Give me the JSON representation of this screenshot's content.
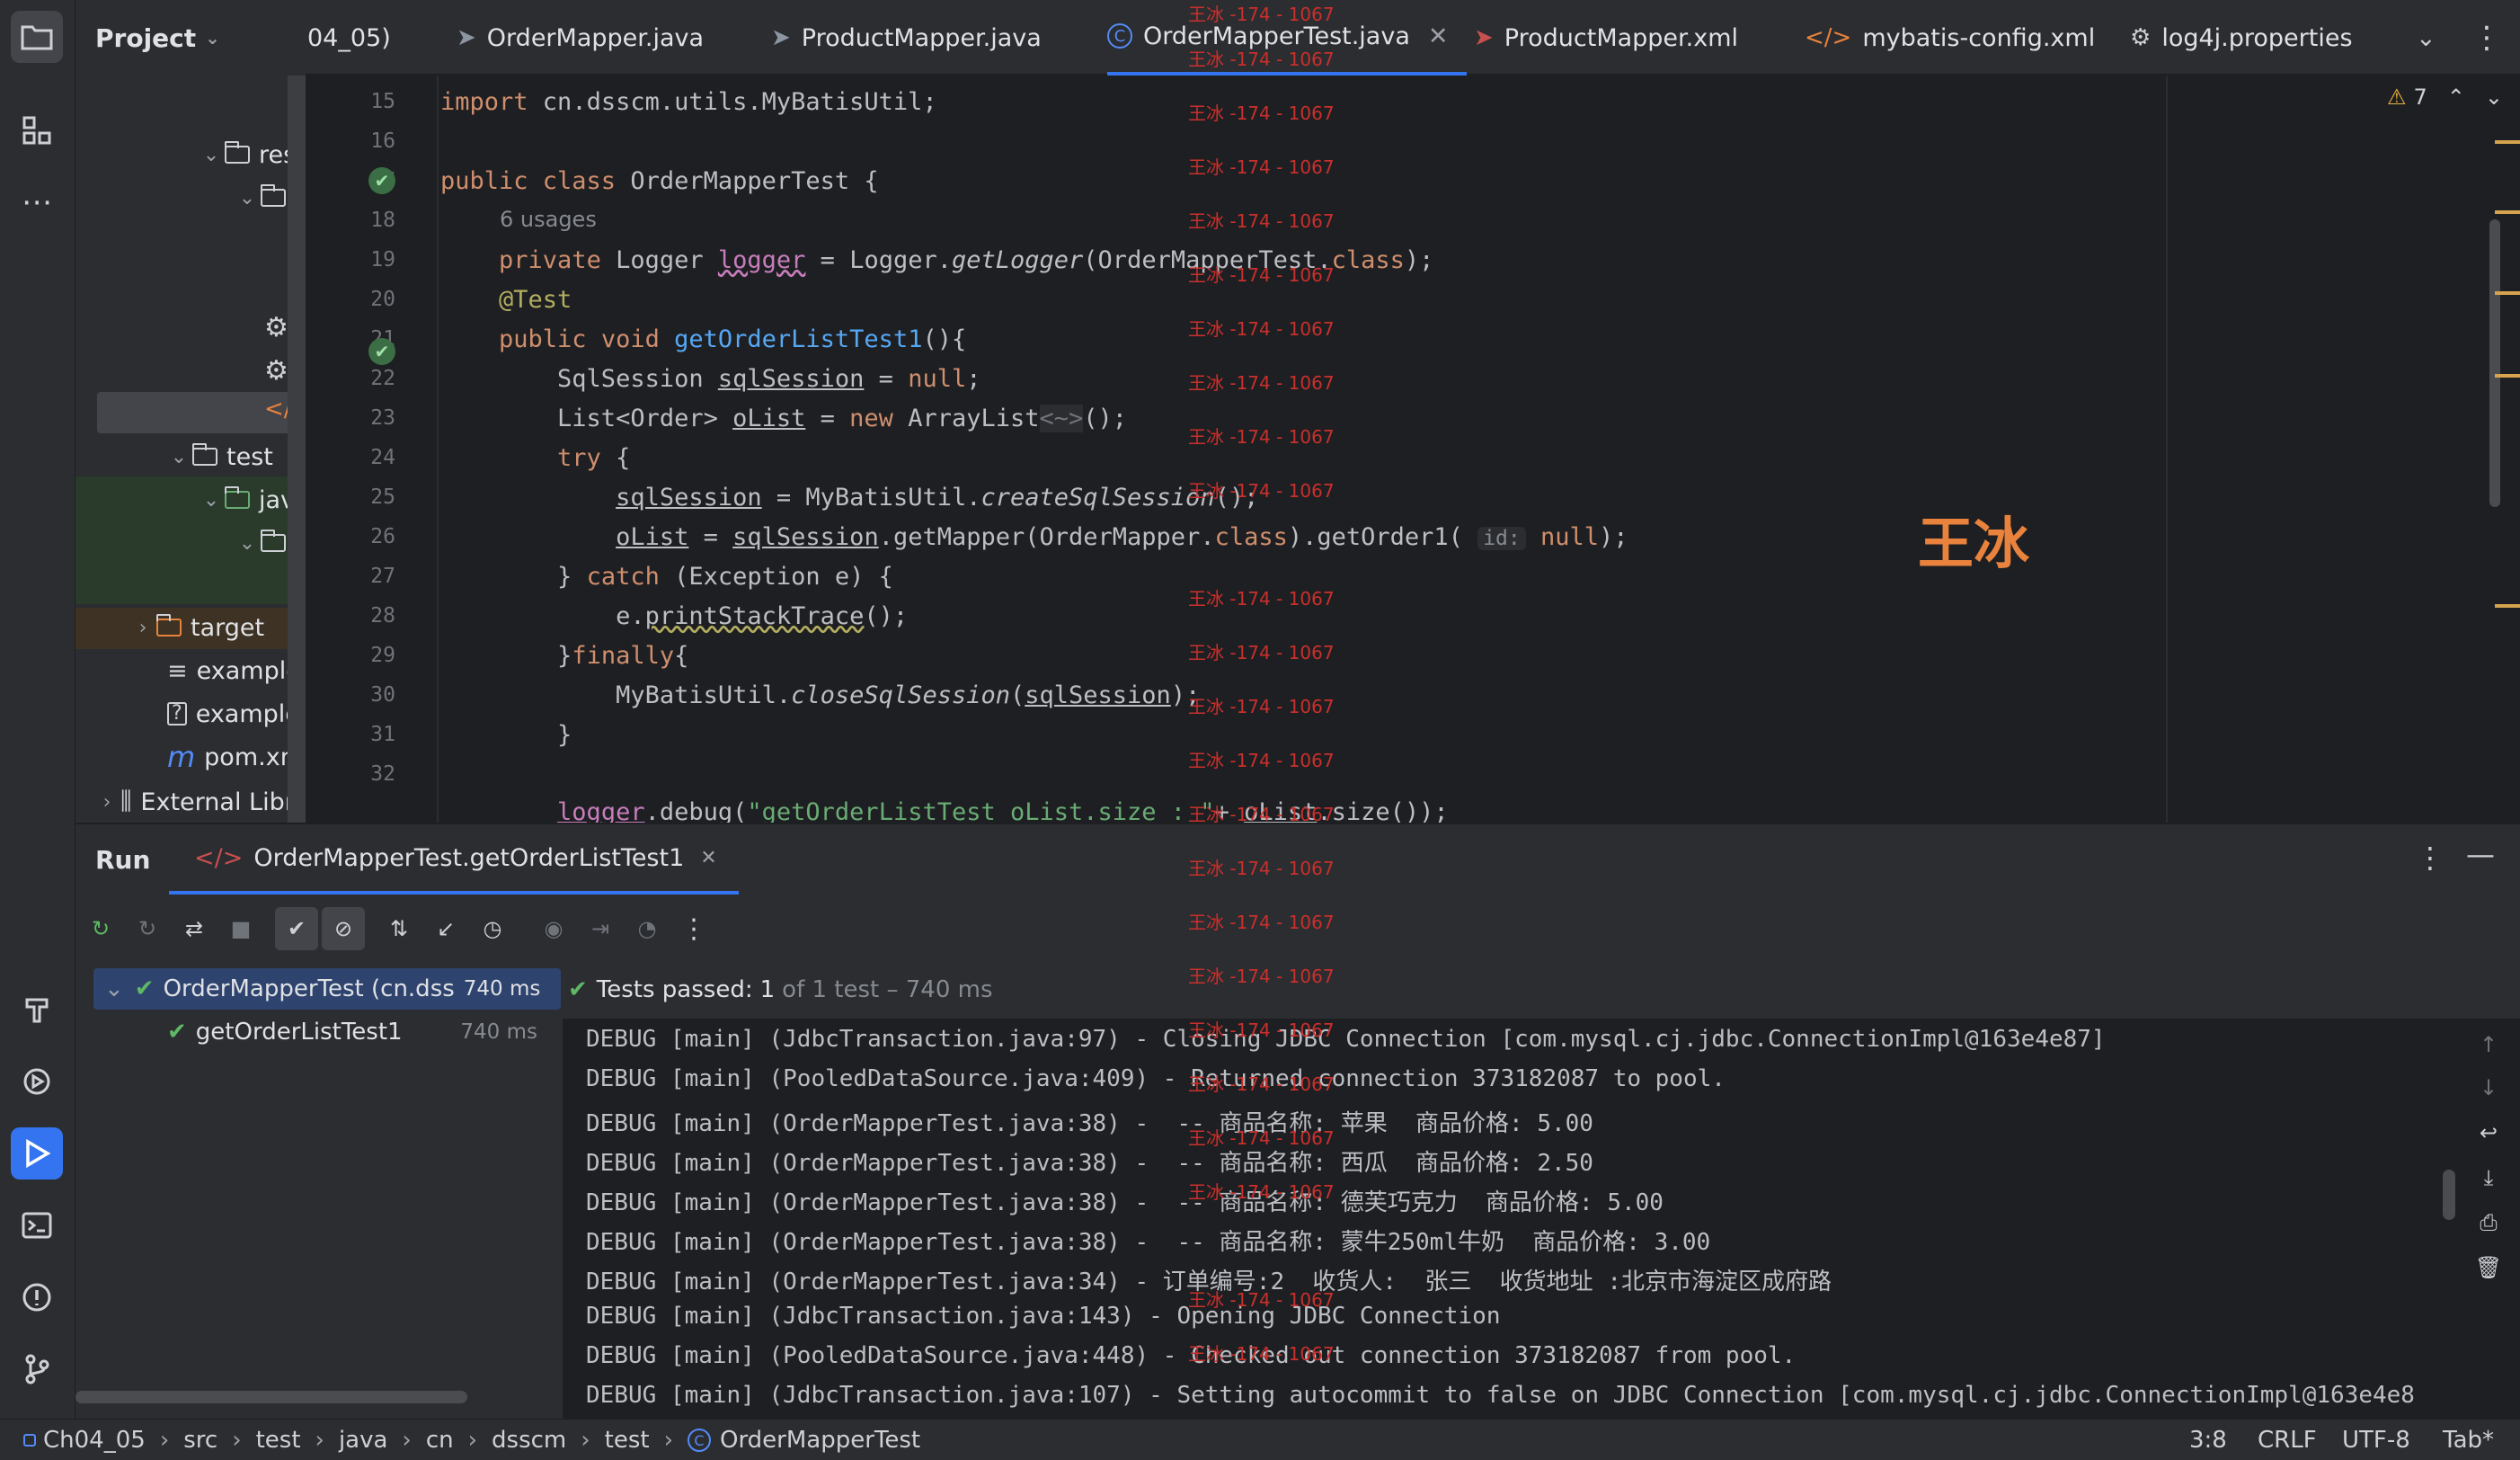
{
  "project_panel": {
    "title": "Project",
    "tree": [
      {
        "label": "res"
      },
      {
        "label": ""
      },
      {
        "label": "test"
      },
      {
        "label": "java"
      },
      {
        "label": ""
      },
      {
        "label": "target"
      },
      {
        "label": "example.l"
      },
      {
        "label": "example.l"
      },
      {
        "label": "pom.xml"
      },
      {
        "label": "External Libr"
      }
    ]
  },
  "tabs": [
    {
      "label": "04_05)",
      "icon": "none"
    },
    {
      "label": "OrderMapper.java",
      "icon": "mapper-icon"
    },
    {
      "label": "ProductMapper.java",
      "icon": "mapper-icon"
    },
    {
      "label": "OrderMapperTest.java",
      "icon": "class-icon",
      "active": true
    },
    {
      "label": "ProductMapper.xml",
      "icon": "mapper-xml-icon"
    },
    {
      "label": "mybatis-config.xml",
      "icon": "xml-icon"
    },
    {
      "label": "log4j.properties",
      "icon": "gear-icon"
    }
  ],
  "editor": {
    "warning_count": "7",
    "usages_hint": "6 usages",
    "param_hint": "id:",
    "line_numbers": [
      "15",
      "16",
      "17",
      "18",
      "19",
      "20",
      "21",
      "22",
      "23",
      "24",
      "25",
      "26",
      "27",
      "28",
      "29",
      "30",
      "31",
      "32"
    ],
    "overlay_text": "王冰",
    "watermark": "王冰 -174 - 1067"
  },
  "run": {
    "title": "Run",
    "tab_label": "OrderMapperTest.getOrderListTest1",
    "tests_passed_label": "Tests passed:",
    "tests_passed_count": "1",
    "tests_passed_detail": "of 1 test – 740 ms",
    "tree": [
      {
        "label": "OrderMapperTest (cn.dss",
        "time": "740 ms"
      },
      {
        "label": "getOrderListTest1",
        "time": "740 ms"
      }
    ],
    "console": [
      "DEBUG [main] (JdbcTransaction.java:97) - Closing JDBC Connection [com.mysql.cj.jdbc.ConnectionImpl@163e4e87]",
      "DEBUG [main] (PooledDataSource.java:409) - Returned connection 373182087 to pool.",
      "DEBUG [main] (OrderMapperTest.java:38) -  -- 商品名称: 苹果  商品价格: 5.00",
      "DEBUG [main] (OrderMapperTest.java:38) -  -- 商品名称: 西瓜  商品价格: 2.50",
      "DEBUG [main] (OrderMapperTest.java:38) -  -- 商品名称: 德芙巧克力  商品价格: 5.00",
      "DEBUG [main] (OrderMapperTest.java:38) -  -- 商品名称: 蒙牛250ml牛奶  商品价格: 3.00",
      "DEBUG [main] (OrderMapperTest.java:34) - 订单编号:2  收货人:  张三  收货地址 :北京市海淀区成府路",
      "DEBUG [main] (JdbcTransaction.java:143) - Opening JDBC Connection",
      "DEBUG [main] (PooledDataSource.java:448) - Checked out connection 373182087 from pool.",
      "DEBUG [main] (JdbcTransaction.java:107) - Setting autocommit to false on JDBC Connection [com.mysql.cj.jdbc.ConnectionImpl@163e4e8"
    ]
  },
  "statusbar": {
    "crumbs": [
      "Ch04_05",
      "src",
      "test",
      "java",
      "cn",
      "dsscm",
      "test",
      "OrderMapperTest"
    ],
    "position": "3:8",
    "line_sep": "CRLF",
    "encoding": "UTF-8",
    "indent": "Tab*"
  }
}
